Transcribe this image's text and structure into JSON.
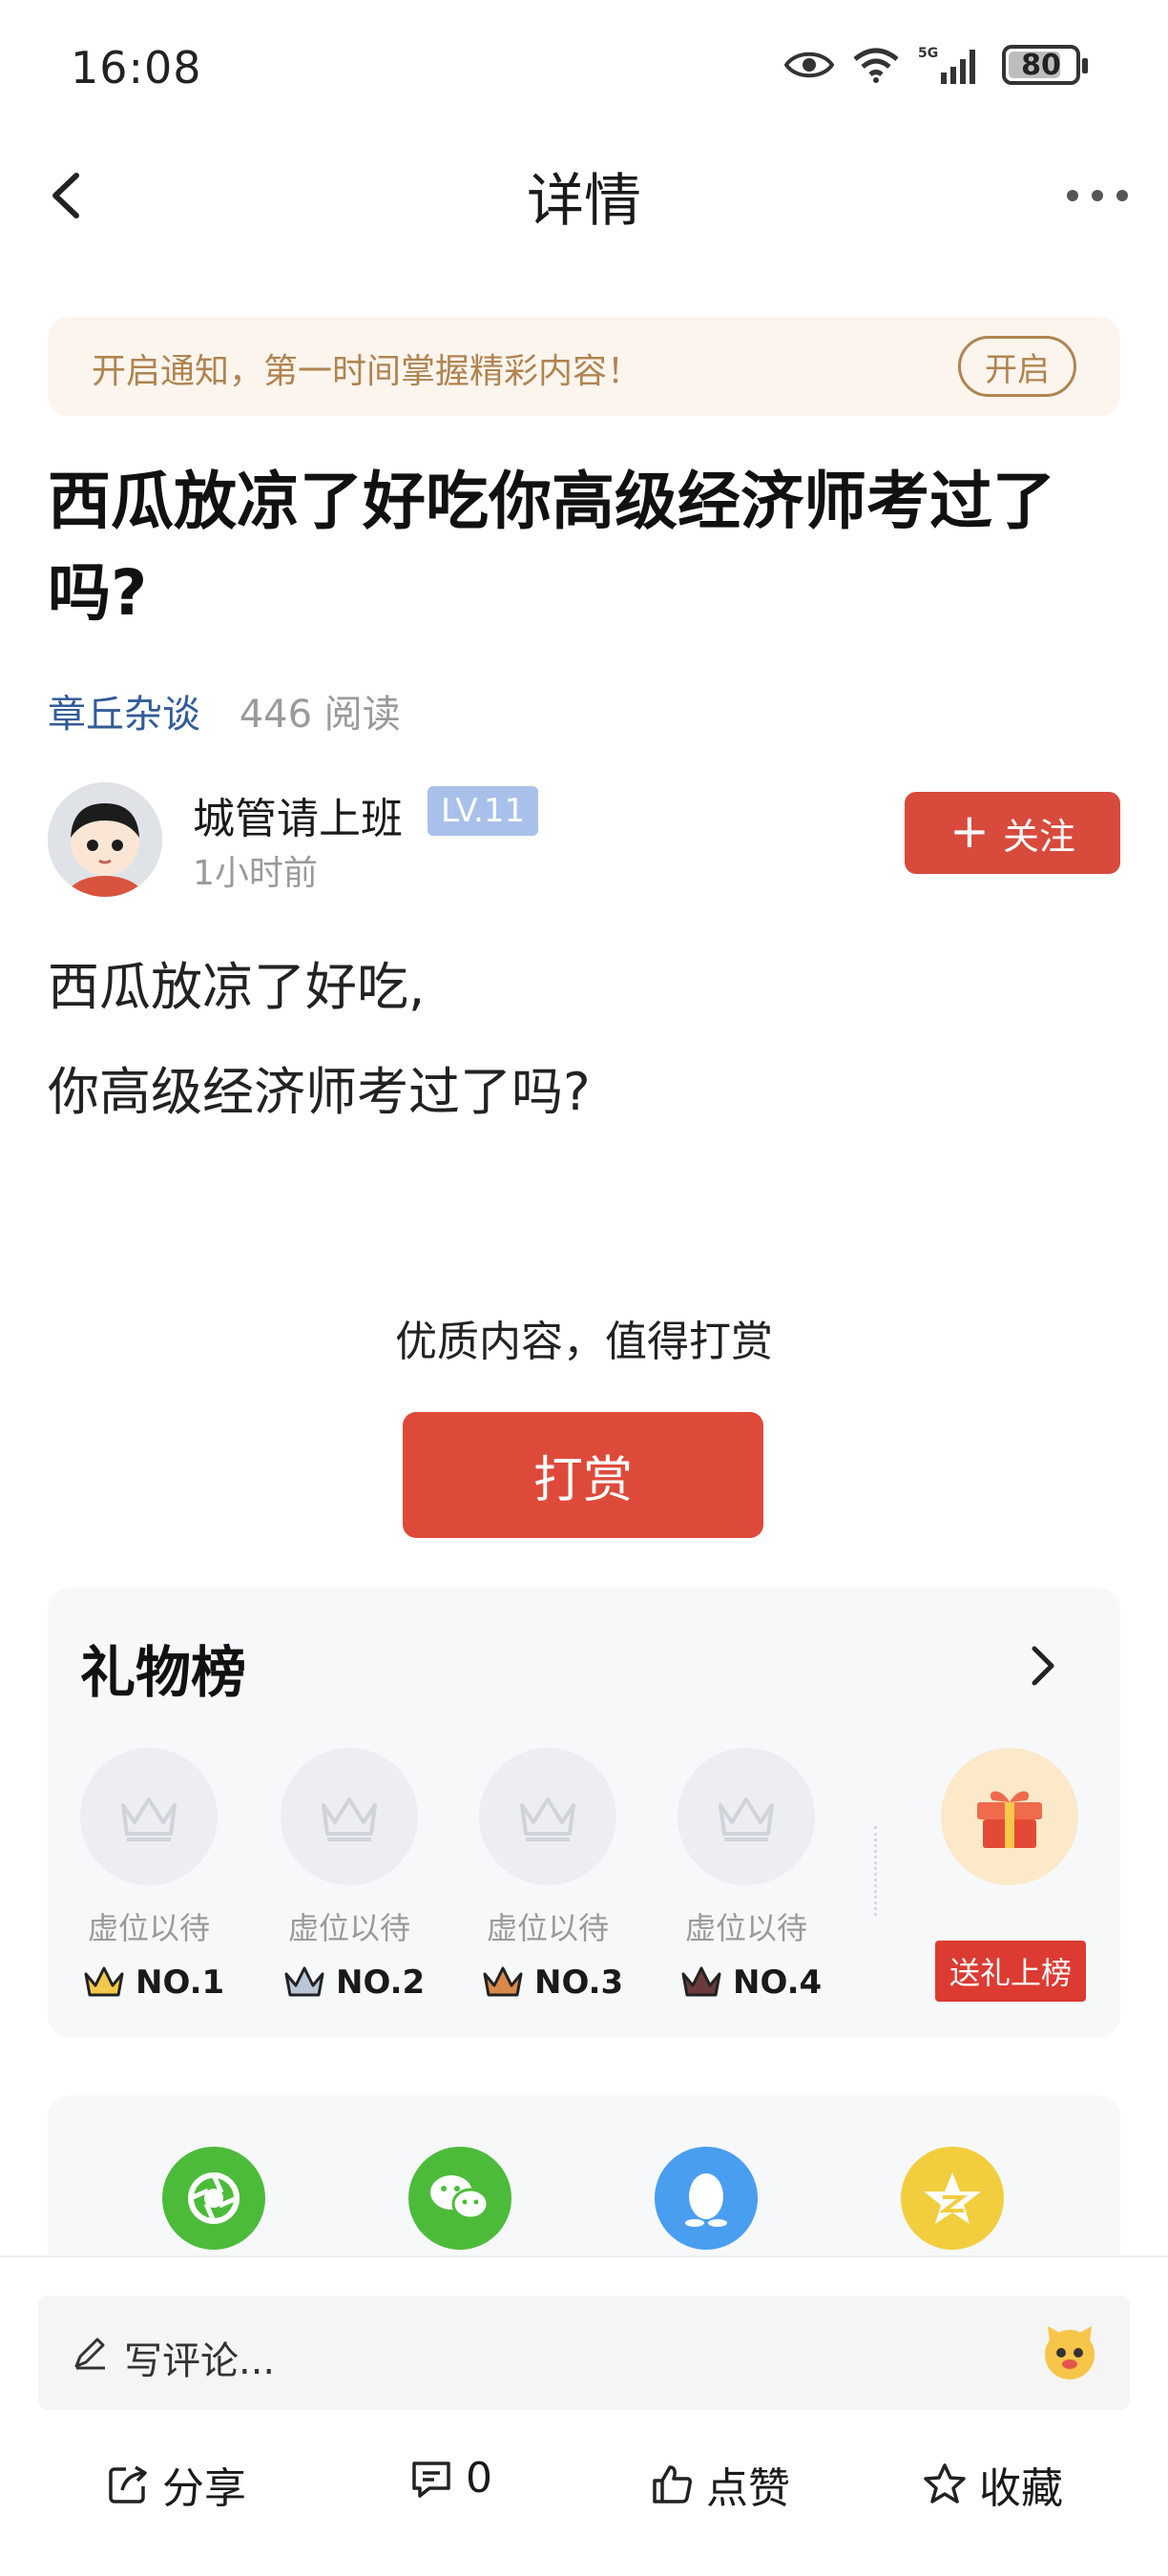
{
  "status_bar": {
    "time": "16:08",
    "network": "5G",
    "battery": "80",
    "battery_percent": 80
  },
  "nav": {
    "title": "详情",
    "back_icon": "chevron-left-icon",
    "more_icon": "more-dots-icon"
  },
  "notice": {
    "text": "开启通知，第一时间掌握精彩内容！",
    "button": "开启"
  },
  "article": {
    "title": "西瓜放凉了好吃你高级经济师考过了吗?",
    "channel": "章丘杂谈",
    "reads": "446 阅读",
    "body_lines": [
      "西瓜放凉了好吃,",
      "你高级经济师考过了吗?"
    ]
  },
  "author": {
    "name": "城管请上班",
    "level": "LV.11",
    "time": "1小时前",
    "follow": "关注"
  },
  "reward": {
    "hint": "优质内容，值得打赏",
    "button": "打赏"
  },
  "gift_board": {
    "title": "礼物榜",
    "slots": [
      {
        "label": "虚位以待",
        "rank": "NO.1",
        "crown_color": "#f2c94c"
      },
      {
        "label": "虚位以待",
        "rank": "NO.2",
        "crown_color": "#b9c7d6"
      },
      {
        "label": "虚位以待",
        "rank": "NO.3",
        "crown_color": "#d9894a"
      },
      {
        "label": "虚位以待",
        "rank": "NO.4",
        "crown_color": "#6b3b3b"
      }
    ],
    "send_button": "送礼上榜"
  },
  "share": {
    "icons": [
      {
        "name": "moments-icon",
        "color": "#4cbb3a"
      },
      {
        "name": "wechat-icon",
        "color": "#4cbb3a"
      },
      {
        "name": "qq-icon",
        "color": "#4a9ef0"
      },
      {
        "name": "qzone-icon",
        "color": "#f2cd3e"
      }
    ]
  },
  "bottom": {
    "comment_placeholder": "写评论...",
    "share": "分享",
    "comments": "0",
    "like": "点赞",
    "favorite": "收藏"
  },
  "colors": {
    "accent_red": "#d84a3c",
    "channel_blue": "#335c97",
    "notice_gold": "#b08450"
  }
}
